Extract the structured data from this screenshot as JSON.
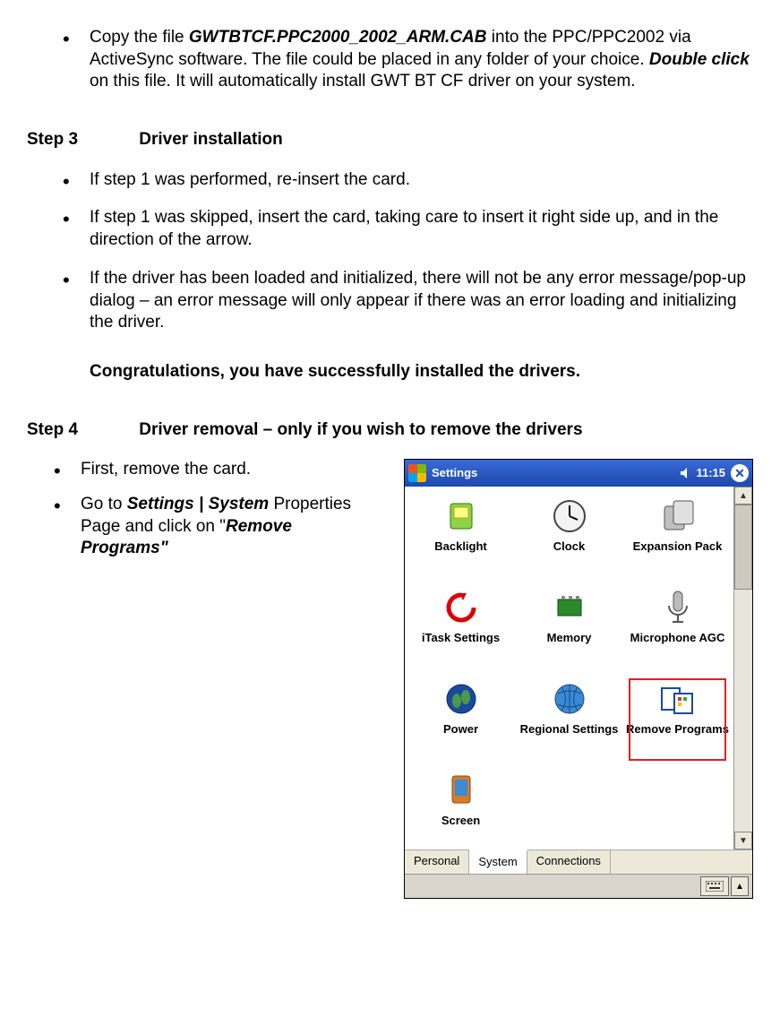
{
  "intro": {
    "copy_prefix": "Copy the file ",
    "filename": "GWTBTCF.PPC2000_2002_ARM.CAB",
    "copy_mid": " into the PPC/PPC2002 via ActiveSync software. The file could be placed in any folder of your choice. ",
    "dblclick": "Double click",
    "copy_suffix": " on this file. It will automatically install GWT BT CF driver on your system."
  },
  "step3": {
    "num": "Step 3",
    "title": "Driver installation",
    "b1": "If step 1 was performed, re-insert the card.",
    "b2": "If step 1 was skipped, insert the card, taking care to insert it right side up, and in the direction of the arrow.",
    "b3": "If the driver has been loaded and initialized, there will not be any error message/pop-up dialog – an error message will only appear if there was an error loading and initializing the driver.",
    "congrats": "Congratulations, you have successfully installed the drivers."
  },
  "step4": {
    "num": "Step 4",
    "title": "Driver removal – only if you wish to remove the drivers",
    "b1": "First, remove the card.",
    "b2_prefix": "Go to ",
    "b2_bold": "Settings | System",
    "b2_mid": " Properties Page and click on \"",
    "b2_bold2": "Remove Programs\"",
    "b2_suffix": ""
  },
  "ppc": {
    "title": "Settings",
    "time": "11:15",
    "items": [
      {
        "label": "Backlight"
      },
      {
        "label": "Clock"
      },
      {
        "label": "Expansion Pack"
      },
      {
        "label": "iTask Settings"
      },
      {
        "label": "Memory"
      },
      {
        "label": "Microphone AGC"
      },
      {
        "label": "Power"
      },
      {
        "label": "Regional Settings"
      },
      {
        "label": "Remove Programs"
      },
      {
        "label": "Screen"
      }
    ],
    "tabs": [
      "Personal",
      "System",
      "Connections"
    ],
    "active_tab": "System"
  }
}
